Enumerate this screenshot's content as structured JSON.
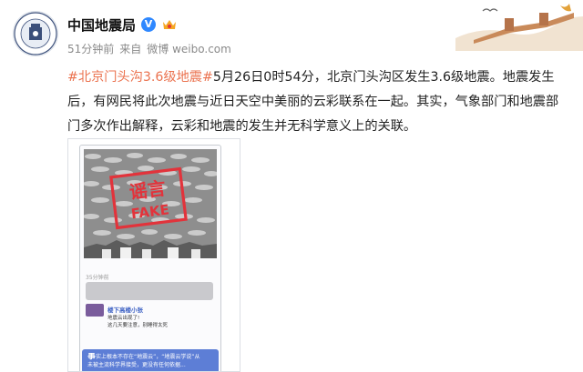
{
  "account": {
    "name": "中国地震局",
    "verified_mark": "V",
    "logo_text": "CHINA EARTHQUAKE ADMINISTRATION",
    "logo_text_cn": "中国地震局"
  },
  "meta": {
    "time": "51分钟前",
    "source_prefix": "来自",
    "source": "微博 weibo.com"
  },
  "post": {
    "hashtag": "#北京门头沟3.6级地震#",
    "text": "5月26日0时54分，北京门头沟区发生3.6级地震。地震发生后，有网民将此次地震与近日天空中美丽的云彩联系在一起。其实，气象部门和地震部门多次作出解释，云彩和地震的发生并无科学意义上的关联。"
  },
  "image": {
    "stamp_cn": "谣言",
    "stamp_en": "FAKE",
    "timestamp": "35分钟前",
    "commenter": "楼下高楼小张",
    "comment_line1": "地震云出现了!",
    "comment_line2": "这几天要注意，别睡得太死",
    "note_lead": "事",
    "note_text": "实上根本不存在“地震云”，“地震云学说”从",
    "note_text2": "未被主流科学界接受，更没有任何依据..."
  },
  "colors": {
    "hashtag": "#eb7350",
    "verified": "#2f88ff",
    "stamp": "#e2333b"
  }
}
